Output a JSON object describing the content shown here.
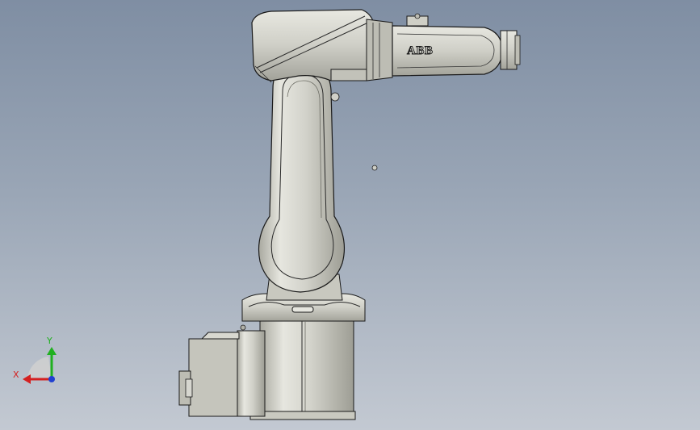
{
  "model": {
    "logo": "ABB"
  },
  "triad": {
    "x_label": "X",
    "y_label": "Y",
    "x_color": "#d42020",
    "y_color": "#20b020",
    "z_color": "#2040d0"
  },
  "colors": {
    "background_top": "#7f8ea3",
    "background_bottom": "#c3c9d2",
    "robot_body": "#cfcfc6",
    "outline": "#1a1a1a"
  }
}
